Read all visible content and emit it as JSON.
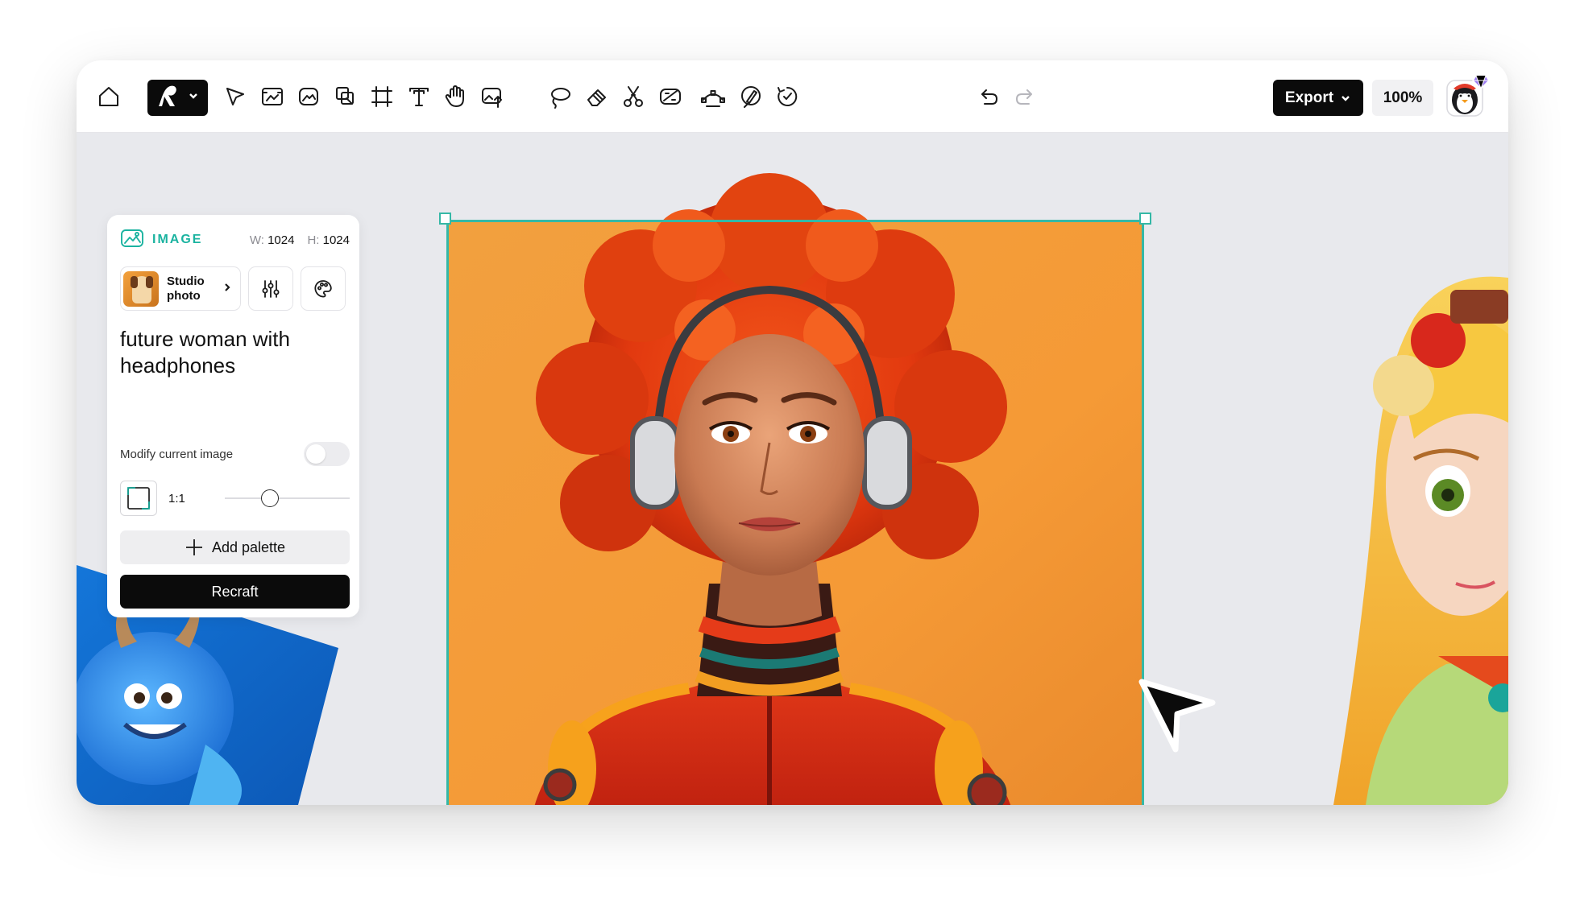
{
  "toolbar": {
    "left_tools": [
      "home-icon",
      "brand-logo",
      "pointer-icon",
      "image-frame-icon",
      "image-generate-icon",
      "layers-icon",
      "frame-icon",
      "text-icon",
      "hand-icon",
      "upload-image-icon"
    ],
    "center_tools": [
      "lasso-icon",
      "eraser-icon",
      "scissors-icon",
      "remove-background-icon",
      "vectorize-icon",
      "inpaint-icon",
      "mockup-icon"
    ],
    "export_label": "Export",
    "zoom_label": "100%"
  },
  "panel": {
    "type_label": "IMAGE",
    "width_key": "W:",
    "width_value": "1024",
    "height_key": "H:",
    "height_value": "1024",
    "style": {
      "name": "Studio photo"
    },
    "prompt": "future woman with headphones",
    "modify_label": "Modify current image",
    "modify_enabled": false,
    "ratio_label": "1:1",
    "ratio_slider": 0.34,
    "palette_label": "Add palette",
    "recraft_label": "Recraft"
  },
  "colors": {
    "accent": "#35b8a6",
    "canvas_bg": "#e8e9ed",
    "primary_button": "#0b0b0b"
  }
}
